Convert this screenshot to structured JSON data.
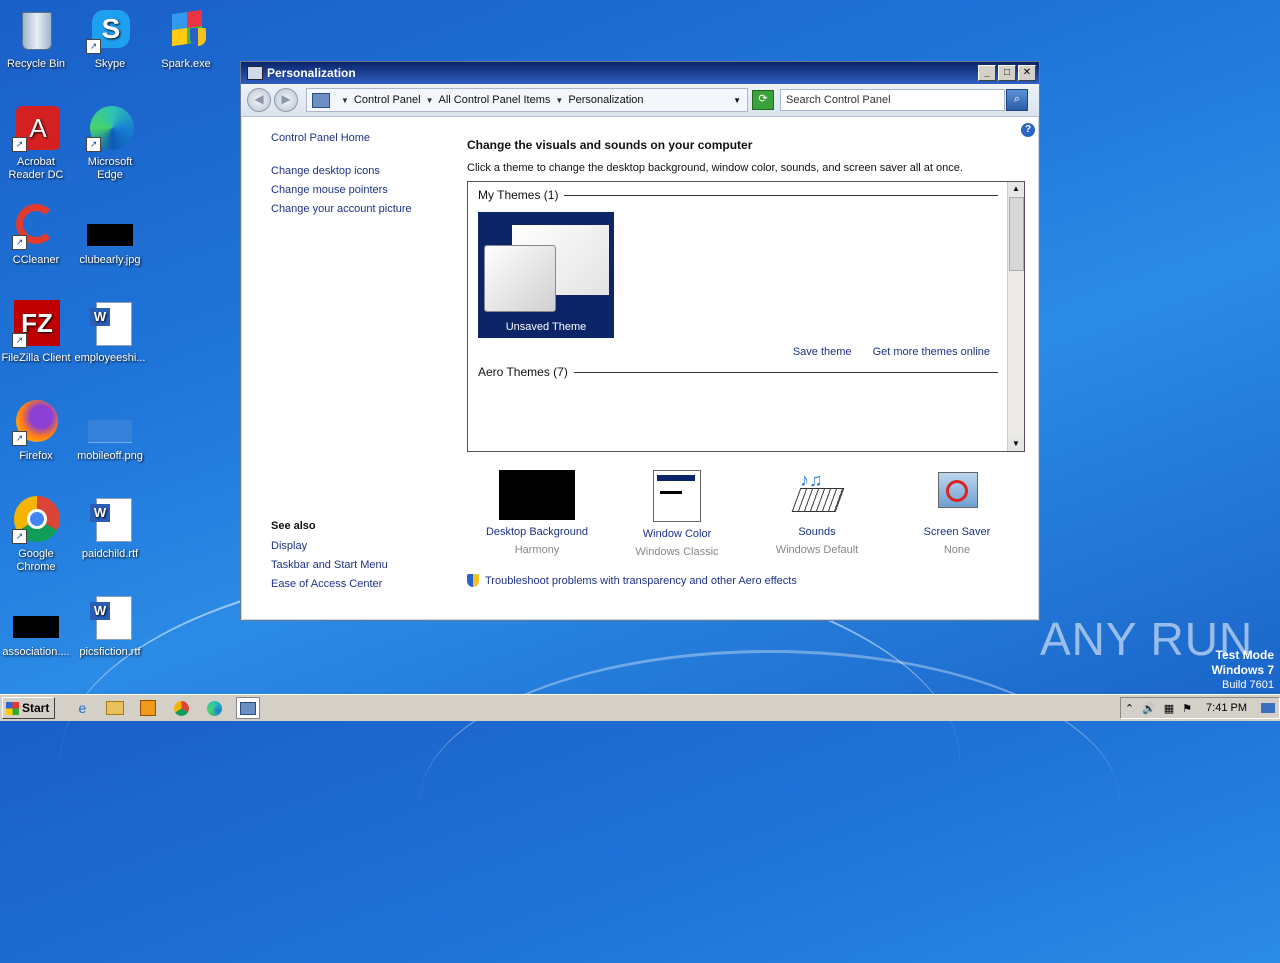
{
  "desktop": {
    "icons": [
      {
        "label": "Recycle Bin",
        "icon": "recycle-bin-icon"
      },
      {
        "label": "Skype",
        "icon": "skype-icon"
      },
      {
        "label": "Spark.exe",
        "icon": "windows-flag-icon"
      },
      {
        "label": "Acrobat Reader DC",
        "icon": "acrobat-icon"
      },
      {
        "label": "Microsoft Edge",
        "icon": "edge-icon"
      },
      {
        "label": "CCleaner",
        "icon": "ccleaner-icon"
      },
      {
        "label": "clubearly.jpg",
        "icon": "image-file-icon"
      },
      {
        "label": "FileZilla Client",
        "icon": "filezilla-icon"
      },
      {
        "label": "employeeshi...",
        "icon": "word-doc-icon"
      },
      {
        "label": "Firefox",
        "icon": "firefox-icon"
      },
      {
        "label": "mobileoff.png",
        "icon": "image-file-icon"
      },
      {
        "label": "Google Chrome",
        "icon": "chrome-icon"
      },
      {
        "label": "paidchild.rtf",
        "icon": "word-doc-icon"
      },
      {
        "label": "association....",
        "icon": "image-file-icon"
      },
      {
        "label": "picsfiction.rtf",
        "icon": "word-doc-icon"
      }
    ]
  },
  "window": {
    "title": "Personalization",
    "address": {
      "crumb1": "Control Panel",
      "crumb2": "All Control Panel Items",
      "crumb3": "Personalization"
    },
    "search_placeholder": "Search Control Panel",
    "left_nav": {
      "home": "Control Panel Home",
      "links": [
        "Change desktop icons",
        "Change mouse pointers",
        "Change your account picture"
      ]
    },
    "see_also": {
      "heading": "See also",
      "links": [
        "Display",
        "Taskbar and Start Menu",
        "Ease of Access Center"
      ]
    },
    "heading": "Change the visuals and sounds on your computer",
    "subheading": "Click a theme to change the desktop background, window color, sounds, and screen saver all at once.",
    "themes": {
      "my_themes": "My Themes (1)",
      "unsaved": "Unsaved Theme",
      "save_link": "Save theme",
      "online_link": "Get more themes online",
      "aero_themes": "Aero Themes (7)"
    },
    "settings": [
      {
        "label": "Desktop Background",
        "value": "Harmony"
      },
      {
        "label": "Window Color",
        "value": "Windows Classic"
      },
      {
        "label": "Sounds",
        "value": "Windows Default"
      },
      {
        "label": "Screen Saver",
        "value": "None"
      }
    ],
    "troubleshoot": "Troubleshoot problems with transparency and other Aero effects"
  },
  "taskbar": {
    "start": "Start",
    "clock": "7:41 PM"
  },
  "watermark": "ANY RUN",
  "test_mode": {
    "line1": "Test Mode",
    "line2": "Windows 7",
    "line3": "Build 7601"
  }
}
